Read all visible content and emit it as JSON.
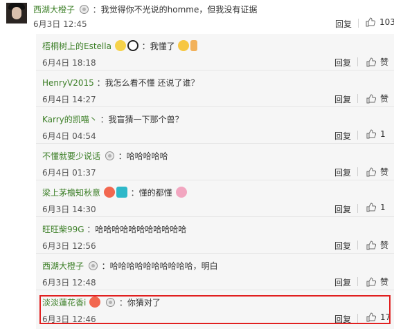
{
  "main_comment": {
    "user": "西湖大橙子",
    "text": "：我觉得你不光说的homme，但我没有证据",
    "time": "6月3日 12:45",
    "reply_label": "回复",
    "likes": "103"
  },
  "replies": [
    {
      "user": "梧桐树上的Estella",
      "text": "：我懂了",
      "time": "6月4日 18:18",
      "reply_label": "回复",
      "likes": "赞",
      "emojis": [
        "e-duck",
        "e-panda",
        "e-grin",
        "e-thumb"
      ]
    },
    {
      "user": "HenryV2015",
      "text": "：我怎么看不懂 还说了谁？",
      "time": "6月4日 14:27",
      "reply_label": "回复",
      "likes": "赞",
      "emojis": []
    },
    {
      "user": "Karry的凯喵丶",
      "text": "：我盲猜一下那个兽？",
      "time": "6月4日 04:54",
      "reply_label": "回复",
      "likes": "1",
      "emojis": []
    },
    {
      "user": "不懂就要少说话",
      "text": "：哈哈哈哈哈",
      "time": "6月4日 01:37",
      "reply_label": "回复",
      "likes": "赞",
      "medal": true,
      "emojis": []
    },
    {
      "user": "梁上茅檐知秋意",
      "text": "：懂的都懂",
      "time": "6月3日 14:30",
      "reply_label": "回复",
      "likes": "1",
      "emojis": [
        "e-flame",
        "e-eye",
        "e-pig"
      ]
    },
    {
      "user": "旺旺柴99G",
      "text": "：哈哈哈哈哈哈哈哈哈哈哈",
      "time": "6月3日 12:56",
      "reply_label": "回复",
      "likes": "赞",
      "emojis": []
    },
    {
      "user": "西湖大橙子",
      "text": "：哈哈哈哈哈哈哈哈哈哈，明白",
      "time": "6月3日 12:48",
      "reply_label": "回复",
      "likes": "赞",
      "medal": true,
      "emojis": []
    },
    {
      "user": "淡淡蓮花香i",
      "text": "：你猜对了",
      "time": "6月3日 12:46",
      "reply_label": "回复",
      "likes": "17",
      "medal": true,
      "emojis": [
        "e-flame"
      ]
    }
  ],
  "colors": {
    "username": "#3c7f27",
    "highlight_border": "#e12020",
    "reply_bg": "#f6f6f6"
  }
}
